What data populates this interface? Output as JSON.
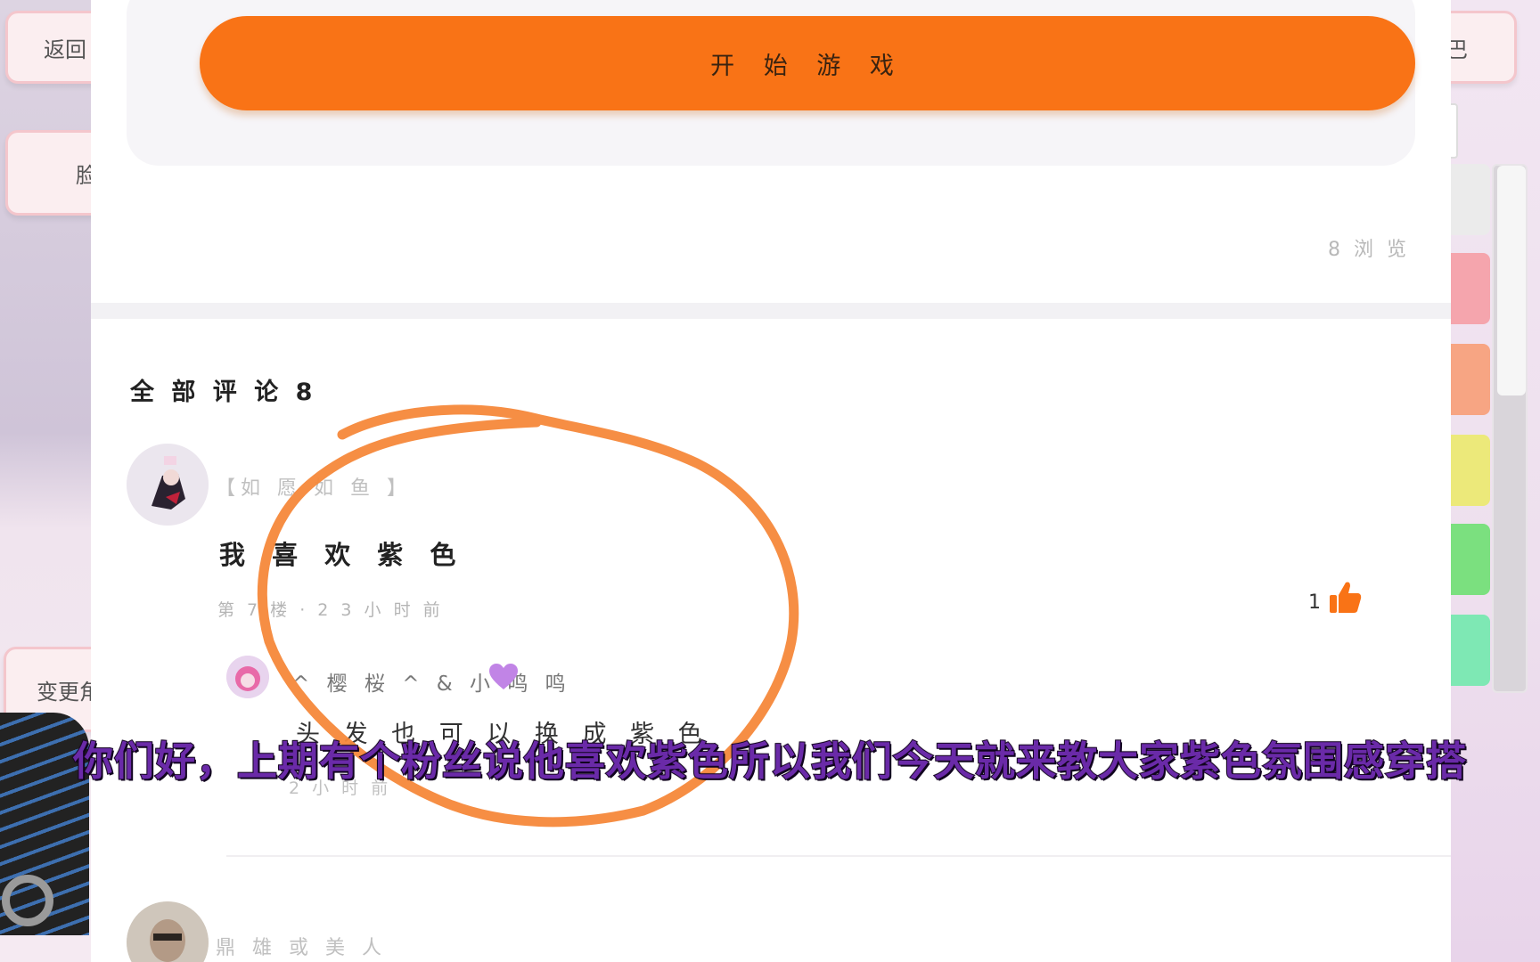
{
  "left_buttons": {
    "back": "返回",
    "face": "脸",
    "change": "变更角"
  },
  "right_buttons": {
    "top": "巴"
  },
  "color_swatches": [
    "#f5a5ad",
    "#f7a583",
    "#ece97a",
    "#7be07f",
    "#7ee8b4"
  ],
  "start_button": "开 始 游 戏",
  "read_count": "8 浏 览",
  "comments_header": "全 部 评 论 8",
  "comments": [
    {
      "username": "【如 愿 如 鱼 】",
      "text": "我 喜 欢 紫 色",
      "meta": "第 7 楼 · 2 3 小 时 前",
      "likes": "1",
      "reply": {
        "username": "^ 樱 桜 ^ & 小 鸣 鸣",
        "text": "头 发 也 可 以 换 成 紫 色",
        "time": "2 小 时 前"
      }
    },
    {
      "username": "鼎 雄 或 美 人"
    }
  ],
  "subtitle": "你们好，上期有个粉丝说他喜欢紫色所以我们今天就来教大家紫色氛围感穿搭",
  "colors": {
    "accent_orange": "#f97316",
    "annotation_circle": "#f6883a",
    "subtitle_purple": "#6a2aa8"
  }
}
